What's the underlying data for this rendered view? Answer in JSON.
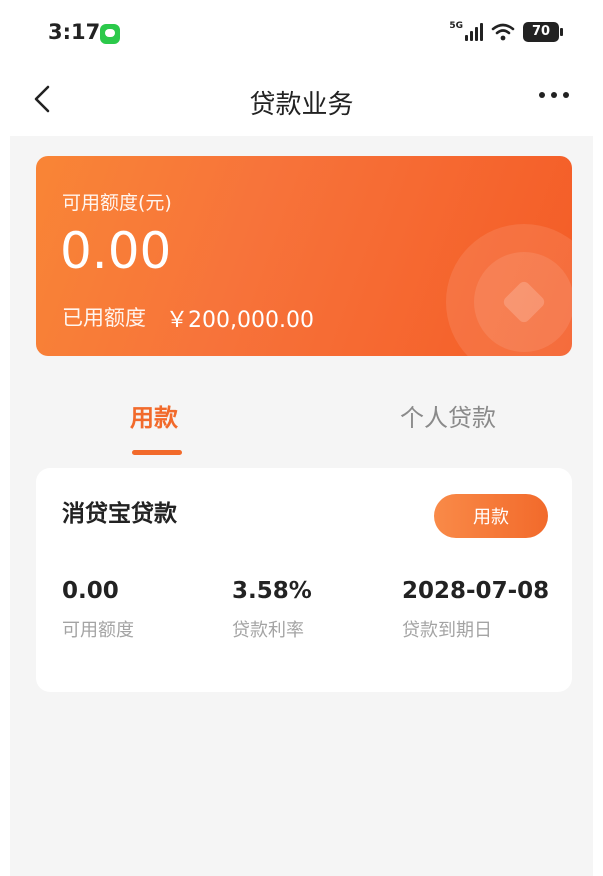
{
  "status_bar": {
    "time": "3:17",
    "network": "5G",
    "battery": "70"
  },
  "header": {
    "title": "贷款业务"
  },
  "credit_card": {
    "available_label": "可用额度(元)",
    "available_amount": "0.00",
    "used_label": "已用额度",
    "used_amount": "￥200,000.00"
  },
  "tabs": [
    {
      "label": "用款",
      "active": true
    },
    {
      "label": "个人贷款",
      "active": false
    }
  ],
  "loan": {
    "name": "消贷宝贷款",
    "action_label": "用款",
    "stats": [
      {
        "value": "0.00",
        "label": "可用额度"
      },
      {
        "value": "3.58%",
        "label": "贷款利率"
      },
      {
        "value": "2028-07-08",
        "label": "贷款到期日"
      }
    ]
  },
  "colors": {
    "accent": "#f26a2b",
    "card_gradient_start": "#f98536",
    "card_gradient_end": "#f45c26",
    "background": "#f5f5f5"
  },
  "icons": [
    "message-icon",
    "signal-icon",
    "wifi-icon",
    "battery-icon",
    "back-chevron-icon",
    "more-icon",
    "coin-icon"
  ]
}
